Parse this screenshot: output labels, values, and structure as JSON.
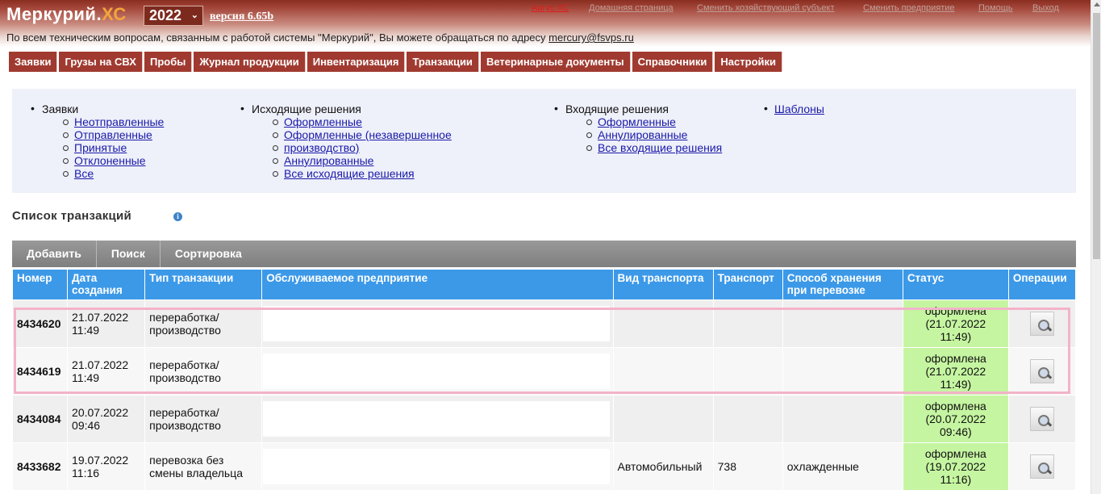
{
  "header": {
    "logo_main": "Меркурий.",
    "logo_xc": "ХС",
    "year": "2022",
    "version": "версия 6.65b",
    "top_links": [
      "Аргус.ХС",
      "Домашняя страница",
      "Сменить хозяйствующий субъект",
      "Сменить предприятие",
      "Помощь",
      "Выход"
    ],
    "support_text": "По всем техническим вопросам, связанным с работой системы \"Меркурий\", Вы можете обращаться по адресу ",
    "support_email": "mercury@fsvps.ru"
  },
  "main_menu": [
    "Заявки",
    "Грузы на СВХ",
    "Пробы",
    "Журнал продукции",
    "Инвентаризация",
    "Транзакции",
    "Ветеринарные документы",
    "Справочники",
    "Настройки"
  ],
  "submenu": {
    "col1": {
      "head": "Заявки",
      "items": [
        "Неотправленные",
        "Отправленные",
        "Принятые",
        "Отклоненные",
        "Все"
      ]
    },
    "col2": {
      "head": "Исходящие решения",
      "items": [
        "Оформленные",
        "Оформленные (незавершенное",
        "производство)",
        "Аннулированные",
        "Все исходящие решения"
      ]
    },
    "col3": {
      "head": "Входящие решения",
      "items": [
        "Оформленные",
        "Аннулированные",
        "Все входящие решения"
      ]
    },
    "col4": "Шаблоны"
  },
  "list_title": "Список транзакций",
  "toolbar": [
    "Добавить",
    "Поиск",
    "Сортировка"
  ],
  "table": {
    "headers": [
      "Номер",
      "Дата создания",
      "Тип транзакции",
      "Обслуживаемое предприятие",
      "Вид транспорта",
      "Транспорт",
      "Способ хранения при перевозке",
      "Статус",
      "Операции"
    ],
    "rows": [
      {
        "num": "8434620",
        "date": "21.07.2022",
        "time": "11:49",
        "type1": "переработка/",
        "type2": "производство",
        "vid": "",
        "transport": "",
        "storage": "",
        "status1": "оформлена",
        "status2": "(21.07.2022",
        "status3": "11:49)"
      },
      {
        "num": "8434619",
        "date": "21.07.2022",
        "time": "11:49",
        "type1": "переработка/",
        "type2": "производство",
        "vid": "",
        "transport": "",
        "storage": "",
        "status1": "оформлена",
        "status2": "(21.07.2022",
        "status3": "11:49)"
      },
      {
        "num": "8434084",
        "date": "20.07.2022",
        "time": "09:46",
        "type1": "переработка/",
        "type2": "производство",
        "vid": "",
        "transport": "",
        "storage": "",
        "status1": "оформлена",
        "status2": "(20.07.2022",
        "status3": "09:46)"
      },
      {
        "num": "8433682",
        "date": "19.07.2022",
        "time": "11:16",
        "type1": "перевозка без",
        "type2": "смены владельца",
        "vid": "Автомобильный",
        "transport": "738",
        "storage": "охлажденные",
        "status1": "оформлена",
        "status2": "(19.07.2022",
        "status3": "11:16)"
      }
    ]
  },
  "colors": {
    "menu_bg": "#a03a30",
    "table_header": "#3c99e8",
    "status_bg": "#c5f5a1",
    "highlight": "#f3b3c9"
  }
}
